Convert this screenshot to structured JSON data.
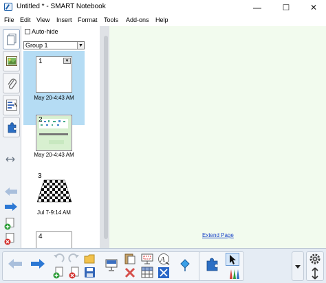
{
  "window": {
    "title": "Untitled * - SMART Notebook",
    "controls": [
      "—",
      "☐",
      "✕"
    ]
  },
  "menu": [
    "File",
    "Edit",
    "View",
    "Insert",
    "Format",
    "Tools",
    "Add-ons",
    "Help"
  ],
  "sorter": {
    "autohide_label": "Auto-hide",
    "group_label": "Group 1",
    "pages": [
      {
        "number": "1",
        "caption": "May 20-4:43 AM",
        "selected": true
      },
      {
        "number": "2",
        "caption": "May 20-4:43 AM",
        "selected": false
      },
      {
        "number": "3",
        "caption": "Jul 7-9:14 AM",
        "selected": false
      },
      {
        "number": "4",
        "caption": "",
        "selected": false
      }
    ]
  },
  "canvas": {
    "extend_label": "Extend Page",
    "background": "#f2fbee"
  },
  "colors": {
    "selection": "#b5dcf4",
    "toolbar_bg": "#e5ecf4",
    "arrow_blue": "#2c78d4"
  }
}
